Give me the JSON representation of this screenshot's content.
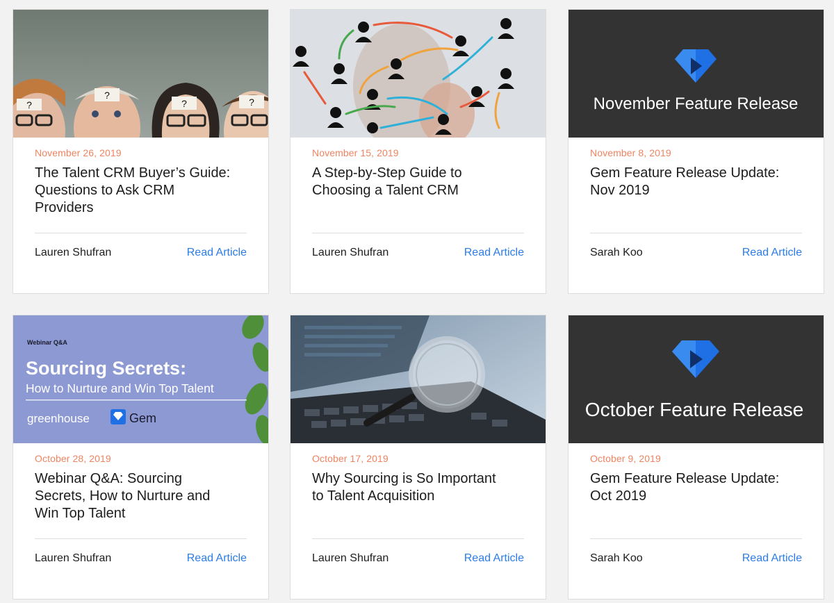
{
  "colors": {
    "date": "#f08460",
    "link": "#2b7de9",
    "title": "#1d1d1d",
    "gem_blue": "#1f6fe5"
  },
  "cards": [
    {
      "image_icon": "people-question-icon",
      "image_question_marks": [
        "?",
        "?",
        "?",
        "?"
      ],
      "date": "November 26, 2019",
      "title": "The Talent CRM Buyer’s Guide:\nQuestions to Ask CRM\nProviders",
      "author": "Lauren Shufran",
      "link": "Read Article"
    },
    {
      "image_icon": "network-arrows-icon",
      "date": "November 15, 2019",
      "title": "A Step-by-Step Guide to\nChoosing a Talent CRM",
      "author": "Lauren Shufran",
      "link": "Read Article"
    },
    {
      "image_icon": "gem-logo-icon",
      "image_text": "November Feature Release",
      "date": "November 8, 2019",
      "title": "Gem Feature Release Update:\nNov 2019",
      "author": "Sarah Koo",
      "link": "Read Article"
    },
    {
      "image_icon": "webinar-banner-icon",
      "image_kicker": "Webinar Q&A",
      "image_headline": "Sourcing Secrets:",
      "image_subline": "How to Nurture and Win Top Talent",
      "image_brand_1": "greenhouse",
      "image_brand_2": "Gem",
      "date": "October 28, 2019",
      "title": "Webinar Q&A: Sourcing\nSecrets, How to Nurture and\nWin Top Talent",
      "author": "Lauren Shufran",
      "link": "Read Article"
    },
    {
      "image_icon": "magnifier-keyboard-icon",
      "date": "October 17, 2019",
      "title": "Why Sourcing is So Important\nto Talent Acquisition",
      "author": "Lauren Shufran",
      "link": "Read Article"
    },
    {
      "image_icon": "gem-logo-icon",
      "image_text": "October Feature Release",
      "date": "October 9, 2019",
      "title": "Gem Feature Release Update:\nOct 2019",
      "author": "Sarah Koo",
      "link": "Read Article"
    }
  ]
}
